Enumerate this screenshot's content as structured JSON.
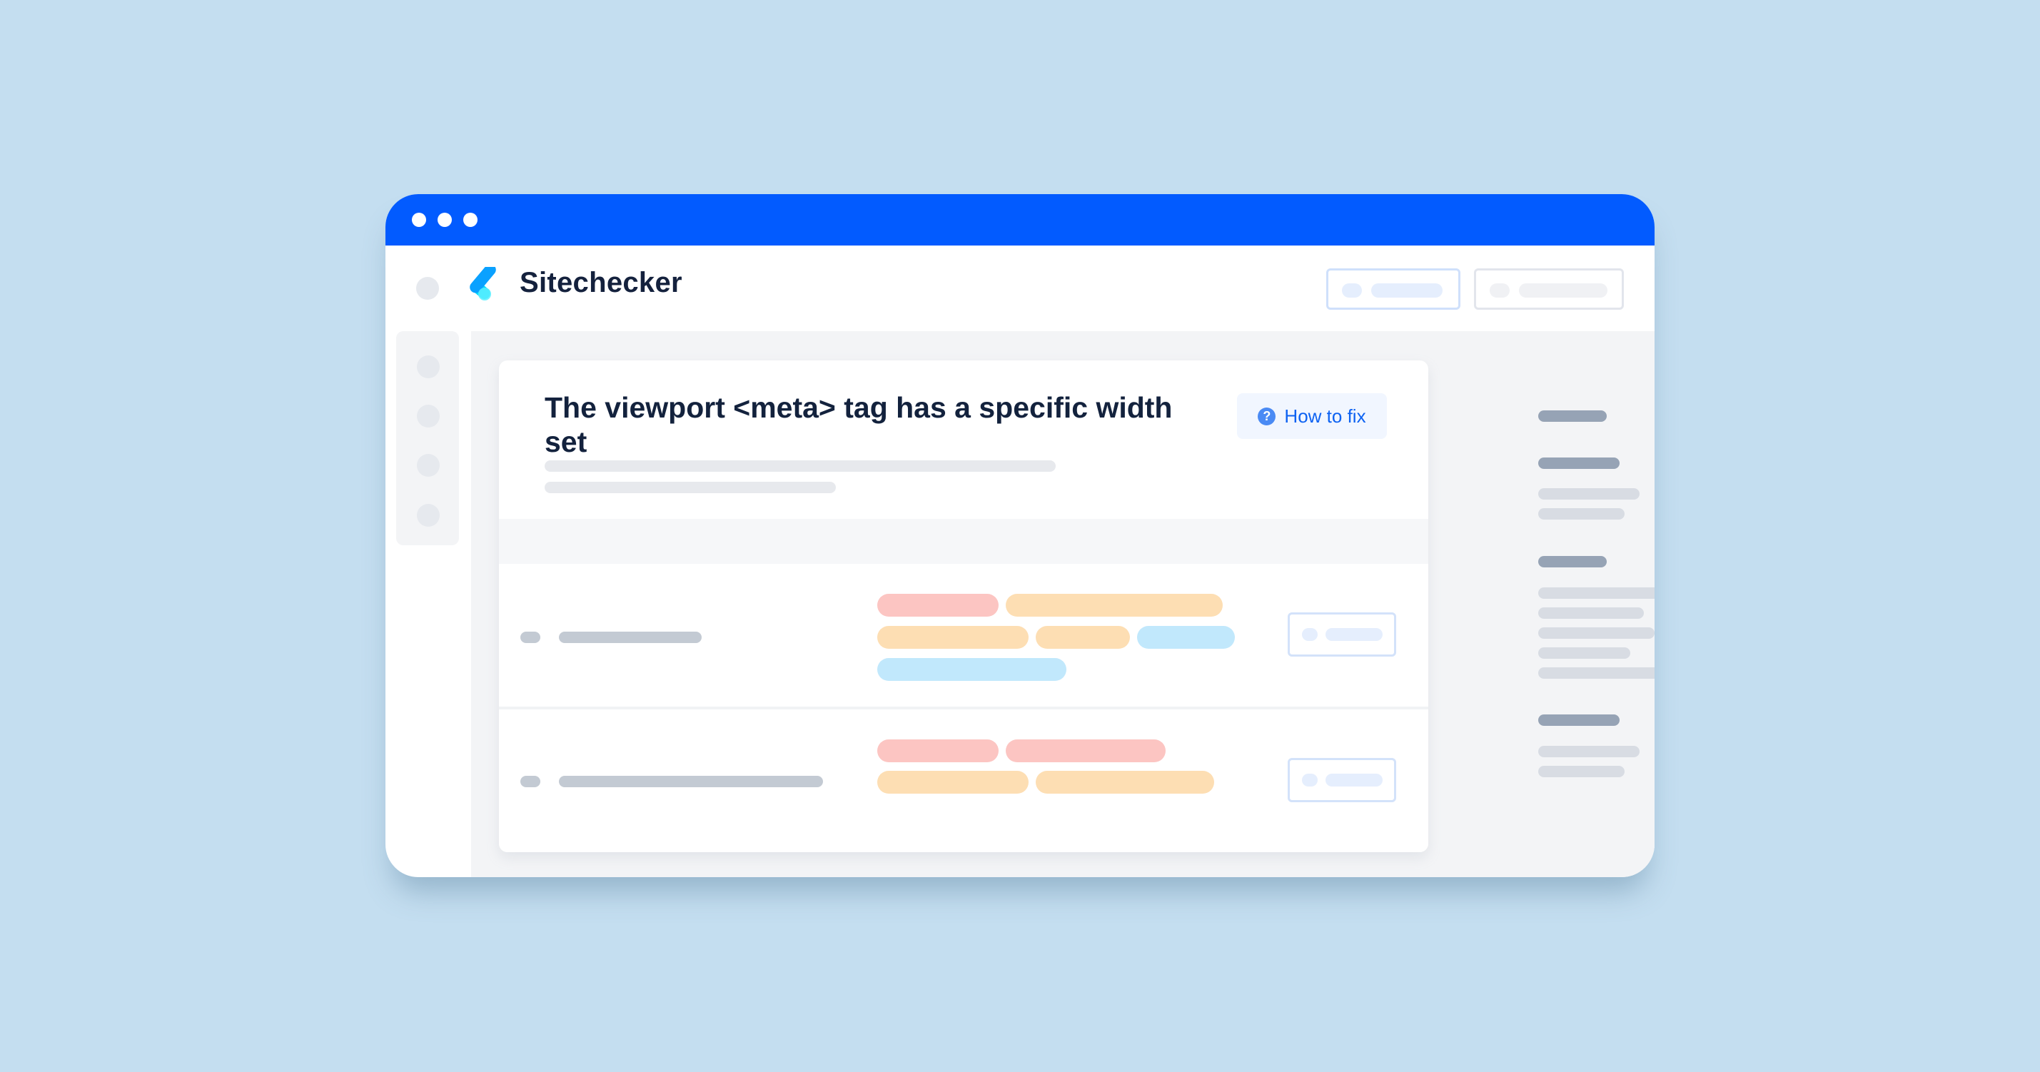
{
  "window": {
    "titlebar_color": "#025bff",
    "titlebar_dots": 3
  },
  "header": {
    "brand_name": "Sitechecker",
    "logo_icon": "checkmark-logo-icon",
    "buttons": [
      {
        "name": "primary-placeholder-button",
        "style": "blue-outline"
      },
      {
        "name": "secondary-placeholder-button",
        "style": "gray-outline"
      }
    ]
  },
  "issue": {
    "title": "The viewport <meta> tag has a specific width set",
    "how_to_fix_label": "How to fix",
    "how_to_fix_icon": "question-circle-icon"
  },
  "table": {
    "rows": [
      {
        "tags": [
          {
            "color": "pink"
          },
          {
            "color": "orange"
          },
          {
            "color": "orange"
          },
          {
            "color": "orange"
          },
          {
            "color": "blue"
          },
          {
            "color": "blue"
          }
        ]
      },
      {
        "tags": [
          {
            "color": "pink"
          },
          {
            "color": "pink"
          },
          {
            "color": "orange"
          },
          {
            "color": "orange"
          }
        ]
      }
    ]
  },
  "side_panel": {
    "groups": [
      {
        "badge_color": "gray",
        "items": 0
      },
      {
        "badge_color": "#fcc5c2",
        "items": 2
      },
      {
        "badge_color": "#fddeb3",
        "items": 5
      },
      {
        "badge_color": "#c1e8fc",
        "items": 2
      }
    ]
  },
  "colors": {
    "background": "#c4def0",
    "accent": "#025bff",
    "link": "#0d62f2",
    "error_tag": "#fcc5c2",
    "warning_tag": "#fddeb3",
    "info_tag": "#c1e8fc"
  }
}
